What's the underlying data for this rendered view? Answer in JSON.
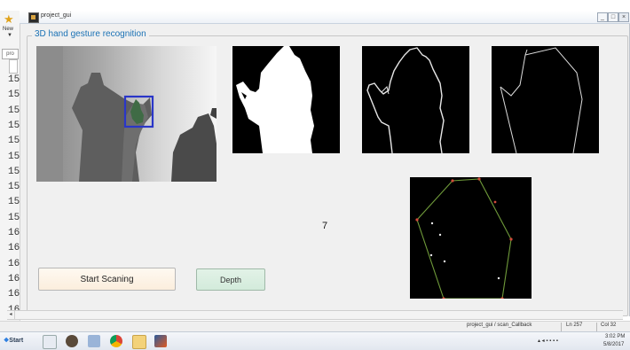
{
  "window": {
    "title": "project_gui",
    "minimize": "_",
    "maximize": "□",
    "close": "×"
  },
  "side": {
    "new_label": "New",
    "arrow": "▼",
    "tab_label": "pro",
    "line_numbers": [
      "15",
      "15",
      "15",
      "15",
      "15",
      "15",
      "15",
      "15",
      "15",
      "15",
      "16",
      "16",
      "16",
      "16",
      "16",
      "16"
    ]
  },
  "panel": {
    "title": "3D hand gesture recognition"
  },
  "result": {
    "gesture_count": "7"
  },
  "buttons": {
    "start": "Start Scaning",
    "depth": "Depth"
  },
  "statusbar": {
    "text": "project_gui / scan_Callback",
    "ln": "Ln  257",
    "col": "Col  32"
  },
  "taskbar": {
    "start": "Start",
    "clock_time": "3:02 PM",
    "clock_date": "5/8/2017"
  },
  "colors": {
    "panel_title": "#1b72b5",
    "depth_button_bg": "#d3ebdb",
    "start_button_bg": "#fbeedd",
    "tracking_box": "#2a36c8"
  },
  "icons": [
    "star-icon",
    "app-icon",
    "start-orb-icon",
    "folder-icon",
    "media-player-icon",
    "chrome-icon",
    "explorer-icon",
    "matlab-icon"
  ]
}
